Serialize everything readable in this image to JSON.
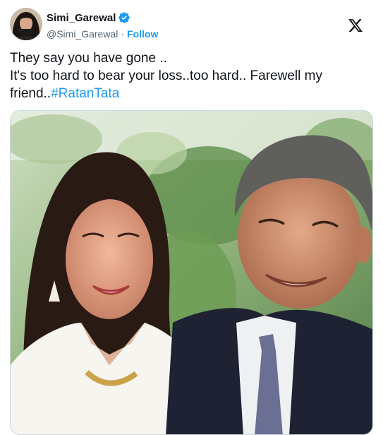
{
  "author": {
    "display_name": "Simi_Garewal",
    "handle": "@Simi_Garewal",
    "separator": "·",
    "follow_label": "Follow",
    "verified": true,
    "avatar_icon": "profile-photo"
  },
  "platform": {
    "logo_icon": "x-logo-icon"
  },
  "tweet": {
    "line1": "They say you have gone ..",
    "line2": "It's too hard to bear your loss..too hard.. Farewell my friend..",
    "hashtag": "#RatanTata"
  },
  "media": {
    "type": "photo"
  },
  "colors": {
    "accent": "#1d9bf0",
    "text_primary": "#0f1419",
    "text_secondary": "#536471",
    "border": "#cfd9de"
  }
}
